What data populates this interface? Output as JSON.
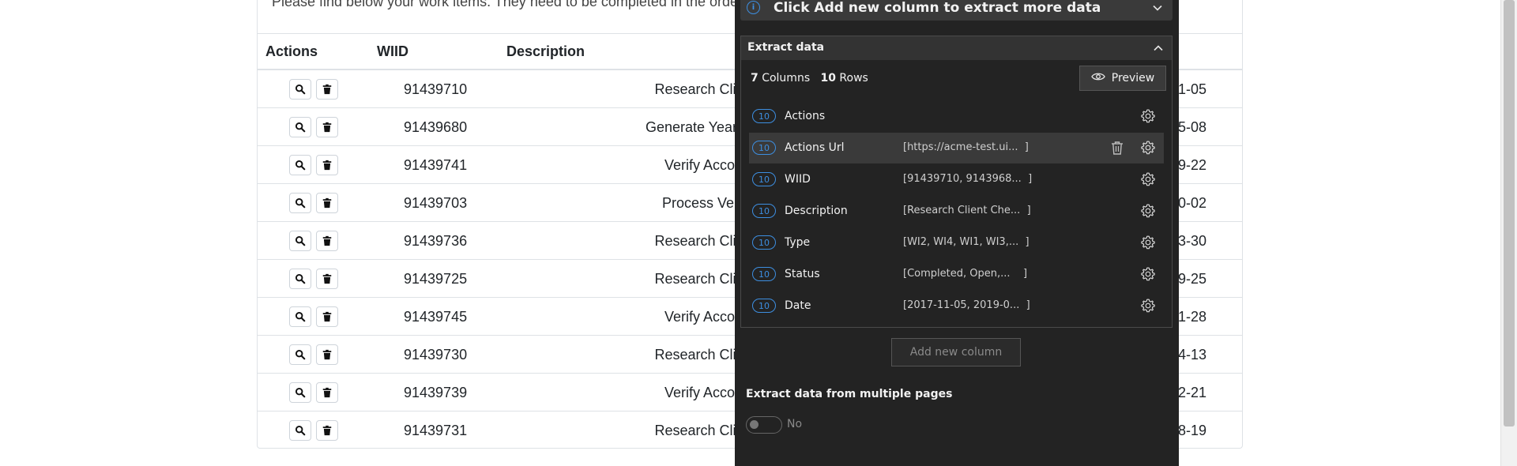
{
  "page": {
    "intro_text": "Please find below your work items. They need to be completed in the order",
    "headers": {
      "actions": "Actions",
      "wiid": "WIID",
      "description": "Description"
    },
    "rows": [
      {
        "wiid": "91439710",
        "description": "Research Client Chec",
        "date_tail": "1-05"
      },
      {
        "wiid": "91439680",
        "description": "Generate Yearly Report f",
        "date_tail": "5-08"
      },
      {
        "wiid": "91439741",
        "description": "Verify Account Pos",
        "date_tail": "9-22"
      },
      {
        "wiid": "91439703",
        "description": "Process Vendor Inv",
        "date_tail": "0-02"
      },
      {
        "wiid": "91439736",
        "description": "Research Client Chec",
        "date_tail": "3-30"
      },
      {
        "wiid": "91439725",
        "description": "Research Client Chec",
        "date_tail": "9-25"
      },
      {
        "wiid": "91439745",
        "description": "Verify Account Pos",
        "date_tail": "1-28"
      },
      {
        "wiid": "91439730",
        "description": "Research Client Chec",
        "date_tail": "4-13"
      },
      {
        "wiid": "91439739",
        "description": "Verify Account Pos",
        "date_tail": "2-21"
      },
      {
        "wiid": "91439731",
        "description": "Research Client Chec",
        "date_tail": "8-19"
      }
    ]
  },
  "panel": {
    "info_text": "Click Add new column to extract more data",
    "section_title": "Extract data",
    "columns_count": "7",
    "columns_label": "Columns",
    "rows_count": "10",
    "rows_label": "Rows",
    "preview_label": "Preview",
    "columns": [
      {
        "count": "10",
        "name": "Actions",
        "preview": ""
      },
      {
        "count": "10",
        "name": "Actions Url",
        "preview": "[https://acme-test.ui...  ]"
      },
      {
        "count": "10",
        "name": "WIID",
        "preview": "[91439710, 9143968...  ]"
      },
      {
        "count": "10",
        "name": "Description",
        "preview": "[Research Client Che...  ]"
      },
      {
        "count": "10",
        "name": "Type",
        "preview": "[WI2, WI4, WI1, WI3,...  ]"
      },
      {
        "count": "10",
        "name": "Status",
        "preview": "[Completed, Open,...    ]"
      },
      {
        "count": "10",
        "name": "Date",
        "preview": "[2017-11-05, 2019-0...  ]"
      }
    ],
    "add_column_label": "Add new column",
    "multi_page_label": "Extract data from multiple pages",
    "toggle_label": "No",
    "accent_color": "#3d8ee0"
  }
}
